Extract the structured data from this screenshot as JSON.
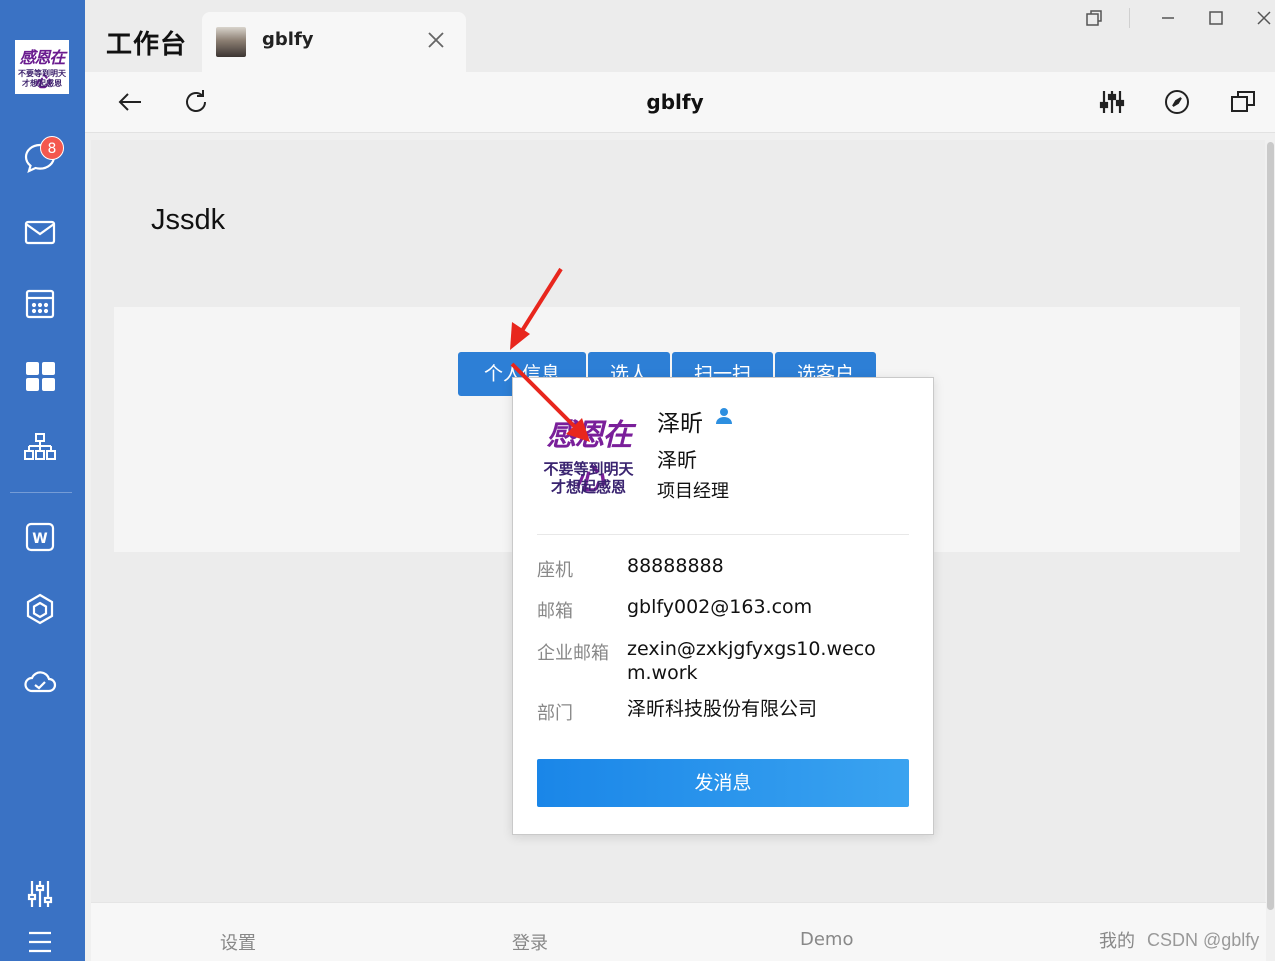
{
  "sidebar": {
    "logo_text_top": "感恩在心",
    "logo_text_bottom": "不要等到明天 才想起感恩",
    "unread_badge": "8",
    "icons": [
      "chat-icon",
      "mail-icon",
      "calendar-icon",
      "workbench-icon",
      "org-chart-icon",
      "word-doc-icon",
      "cube-icon",
      "cloud-icon",
      "settings-sliders-icon",
      "menu-icon"
    ]
  },
  "titlebar": {
    "app_title": "工作台",
    "tab": {
      "label": "gblfy"
    }
  },
  "navbar": {
    "title": "gblfy"
  },
  "page": {
    "heading": "Jssdk",
    "buttons": [
      "个人信息",
      "选人",
      "扫一扫",
      "选客户"
    ]
  },
  "popup": {
    "avatar_text_top": "感恩在心",
    "avatar_text_bottom": "不要等到明天 才想起感恩",
    "name": "泽昕",
    "alias": "泽昕",
    "position": "项目经理",
    "fields": [
      {
        "label": "座机",
        "value": "88888888"
      },
      {
        "label": "邮箱",
        "value": "gblfy002@163.com"
      },
      {
        "label": "企业邮箱",
        "value": "zexin@zxkjgfyxgs10.wecom.work"
      },
      {
        "label": "部门",
        "value": "泽昕科技股份有限公司"
      }
    ],
    "send_button": "发消息"
  },
  "bottombar": {
    "items": [
      "设置",
      "登录",
      "Demo",
      "我的"
    ]
  },
  "watermark": "CSDN @gblfy",
  "colors": {
    "sidebar_bg": "#3a72c4",
    "primary_button": "#2d7fd6",
    "badge": "#f4584e",
    "annotation_arrow": "#e8261d"
  }
}
